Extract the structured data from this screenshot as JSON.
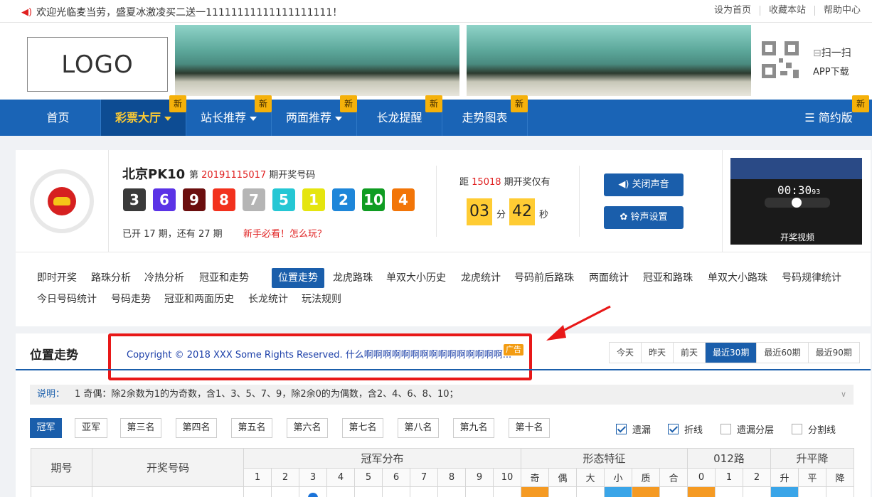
{
  "topbar": {
    "notice": "欢迎光临麦当劳，盛夏冰激凌买二送一11111111111111111111！",
    "links": [
      "设为首页",
      "收藏本站",
      "帮助中心"
    ]
  },
  "header": {
    "logo": "LOGO",
    "scan": "扫一扫",
    "app": "APP下载"
  },
  "nav": {
    "items": [
      {
        "label": "首页",
        "new": false,
        "dropdown": false
      },
      {
        "label": "彩票大厅",
        "new": true,
        "dropdown": true
      },
      {
        "label": "站长推荐",
        "new": true,
        "dropdown": true
      },
      {
        "label": "两面推荐",
        "new": true,
        "dropdown": true
      },
      {
        "label": "长龙提醒",
        "new": true,
        "dropdown": false
      },
      {
        "label": "走势图表",
        "new": true,
        "dropdown": false
      }
    ],
    "new_badge": "新",
    "simple": "简约版"
  },
  "lottery": {
    "name": "北京PK10",
    "issue_prefix": "第",
    "issue": "20191115017",
    "issue_suffix": "期开奖号码",
    "balls": [
      {
        "n": "3",
        "color": "#3a3a3a"
      },
      {
        "n": "6",
        "color": "#5b33e6"
      },
      {
        "n": "9",
        "color": "#6b0e0e"
      },
      {
        "n": "8",
        "color": "#f2311d"
      },
      {
        "n": "7",
        "color": "#b5b5b5"
      },
      {
        "n": "5",
        "color": "#25c7d4"
      },
      {
        "n": "1",
        "color": "#e5e50f"
      },
      {
        "n": "2",
        "color": "#1e86d9"
      },
      {
        "n": "10",
        "color": "#0f9c22"
      },
      {
        "n": "4",
        "color": "#f27508"
      }
    ],
    "opened": "已开 17 期，还有 27 期",
    "howto": "新手必看！怎么玩？",
    "countdown_prefix": "距",
    "countdown_issue": "15018",
    "countdown_suffix": "期开奖仅有",
    "minutes": "03",
    "min_unit": "分",
    "seconds": "42",
    "sec_unit": "秒",
    "btn_sound": "关闭声音",
    "btn_ring": "铃声设置",
    "video_timer": "00:30",
    "video_timer_small": "93",
    "video_label": "开奖视频"
  },
  "tabs": {
    "row1": [
      "即时开奖",
      "路珠分析",
      "冷热分析",
      "冠亚和走势",
      "位置走势",
      "龙虎路珠",
      "单双大小历史",
      "龙虎统计",
      "号码前后路珠",
      "两面统计",
      "冠亚和路珠",
      "单双大小路珠",
      "号码规律统计"
    ],
    "row2": [
      "今日号码统计",
      "号码走势",
      "冠亚和两面历史",
      "长龙统计",
      "玩法规则"
    ],
    "active": "位置走势"
  },
  "panel": {
    "title": "位置走势",
    "ad_text": "Copyright © 2018 XXX Some Rights Reserved. 什么啊啊啊啊啊啊啊啊啊啊啊啊啊啊啊...",
    "ad_tag": "广告",
    "range": [
      "今天",
      "昨天",
      "前天",
      "最近30期",
      "最近60期",
      "最近90期"
    ],
    "range_active": "最近30期",
    "note_label": "说明：",
    "note_text": "1 奇偶：除2余数为1的为奇数，含1、3、5、7、9，除2余0的为偶数，含2、4、6、8、10；",
    "ranks": [
      "冠军",
      "亚军",
      "第三名",
      "第四名",
      "第五名",
      "第六名",
      "第七名",
      "第八名",
      "第九名",
      "第十名"
    ],
    "rank_active": "冠军",
    "options": [
      {
        "label": "遗漏",
        "checked": true
      },
      {
        "label": "折线",
        "checked": true
      },
      {
        "label": "遗漏分层",
        "checked": false
      },
      {
        "label": "分割线",
        "checked": false
      }
    ]
  },
  "table": {
    "col_issue": "期号",
    "col_numbers": "开奖号码",
    "col_dist": "冠军分布",
    "col_form": "形态特征",
    "col_012": "012路",
    "col_trend": "升平降",
    "dist": [
      "1",
      "2",
      "3",
      "4",
      "5",
      "6",
      "7",
      "8",
      "9",
      "10"
    ],
    "form": [
      "奇",
      "偶",
      "大",
      "小",
      "质",
      "合"
    ],
    "road": [
      "0",
      "1",
      "2"
    ],
    "trend": [
      "升",
      "平",
      "降"
    ]
  }
}
